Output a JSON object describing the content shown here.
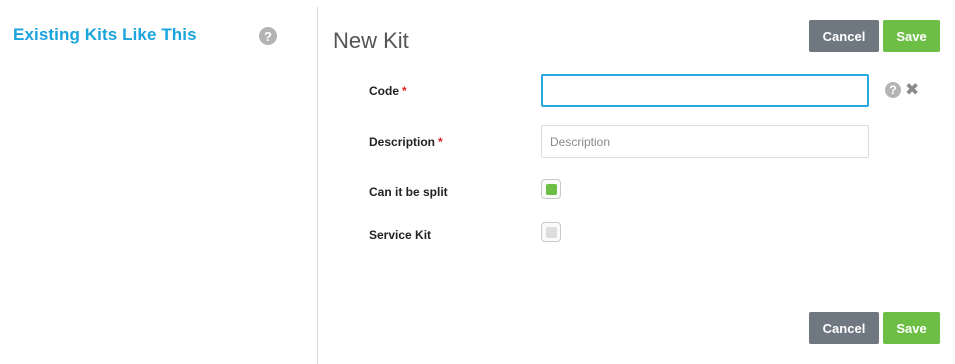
{
  "left_panel": {
    "title": "Existing Kits Like This",
    "help_glyph": "?"
  },
  "form": {
    "title": "New Kit",
    "cancel_label": "Cancel",
    "save_label": "Save",
    "required_mark": "*",
    "fields": {
      "code": {
        "label": "Code",
        "value": "",
        "placeholder": "",
        "required": true,
        "help_glyph": "?",
        "clear_glyph": "✖"
      },
      "description": {
        "label": "Description",
        "value": "",
        "placeholder": "Description",
        "required": true
      },
      "can_split": {
        "label": "Can it be split",
        "checked": true
      },
      "service_kit": {
        "label": "Service Kit",
        "checked": false
      }
    }
  },
  "colors": {
    "accent": "#1aa3dc",
    "save": "#6cbe45",
    "cancel": "#6f7781",
    "required": "#e02020",
    "focus_border": "#28a9e0"
  },
  "icons": {
    "help": "question-circle-icon",
    "clear": "times-icon"
  }
}
